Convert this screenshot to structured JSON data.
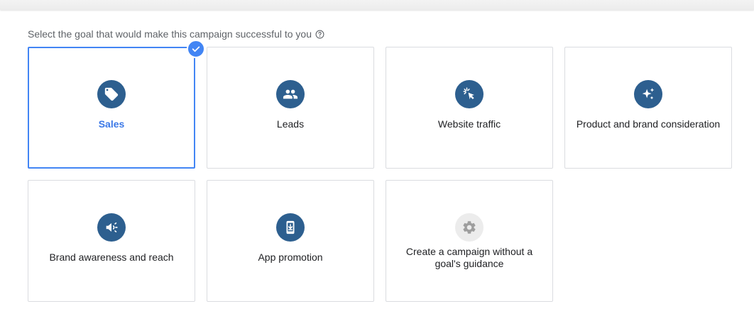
{
  "prompt": {
    "text": "Select the goal that would make this campaign successful to you",
    "help_icon": "help-circle-icon"
  },
  "colors": {
    "accent": "#4285f4",
    "selected_label": "#3b78e7",
    "icon_bg": "#2d5f8f",
    "icon_bg_disabled": "#ececec",
    "border": "#dadce0"
  },
  "goals": [
    {
      "label": "Sales",
      "icon": "sales-tag-icon",
      "selected": true
    },
    {
      "label": "Leads",
      "icon": "people-icon",
      "selected": false
    },
    {
      "label": "Website traffic",
      "icon": "cursor-click-icon",
      "selected": false
    },
    {
      "label": "Product and brand consideration",
      "icon": "sparkle-icon",
      "selected": false
    },
    {
      "label": "Brand awareness and reach",
      "icon": "megaphone-icon",
      "selected": false
    },
    {
      "label": "App promotion",
      "icon": "phone-download-icon",
      "selected": false
    },
    {
      "label": "Create a campaign without a goal's guidance",
      "icon": "gear-icon",
      "selected": false
    }
  ]
}
